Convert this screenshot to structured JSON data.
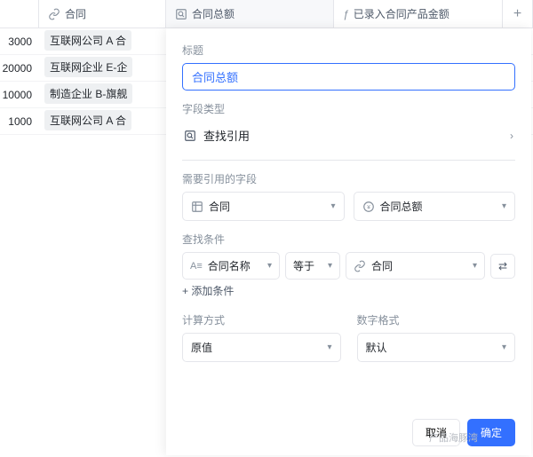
{
  "headers": {
    "col1": "合同",
    "col2": "合同总额",
    "col3": "已录入合同产品金额",
    "add": "+"
  },
  "rows": [
    {
      "num": "3000",
      "tag": "互联网公司 A 合"
    },
    {
      "num": "20000",
      "tag": "互联网企业 E-企"
    },
    {
      "num": "10000",
      "tag": "制造企业 B-旗舰"
    },
    {
      "num": "1000",
      "tag": "互联网公司 A 合"
    }
  ],
  "panel": {
    "title_label": "标题",
    "title_value": "合同总额",
    "field_type_label": "字段类型",
    "field_type_value": "查找引用",
    "ref_label": "需要引用的字段",
    "ref_table": "合同",
    "ref_field": "合同总额",
    "cond_label": "查找条件",
    "cond_field": "合同名称",
    "cond_op": "等于",
    "cond_value": "合同",
    "add_cond": "+ 添加条件",
    "calc_label": "计算方式",
    "calc_value": "原值",
    "fmt_label": "数字格式",
    "fmt_value": "默认",
    "cancel": "取消",
    "confirm": "确定",
    "watermark": "产品海豚湾"
  }
}
